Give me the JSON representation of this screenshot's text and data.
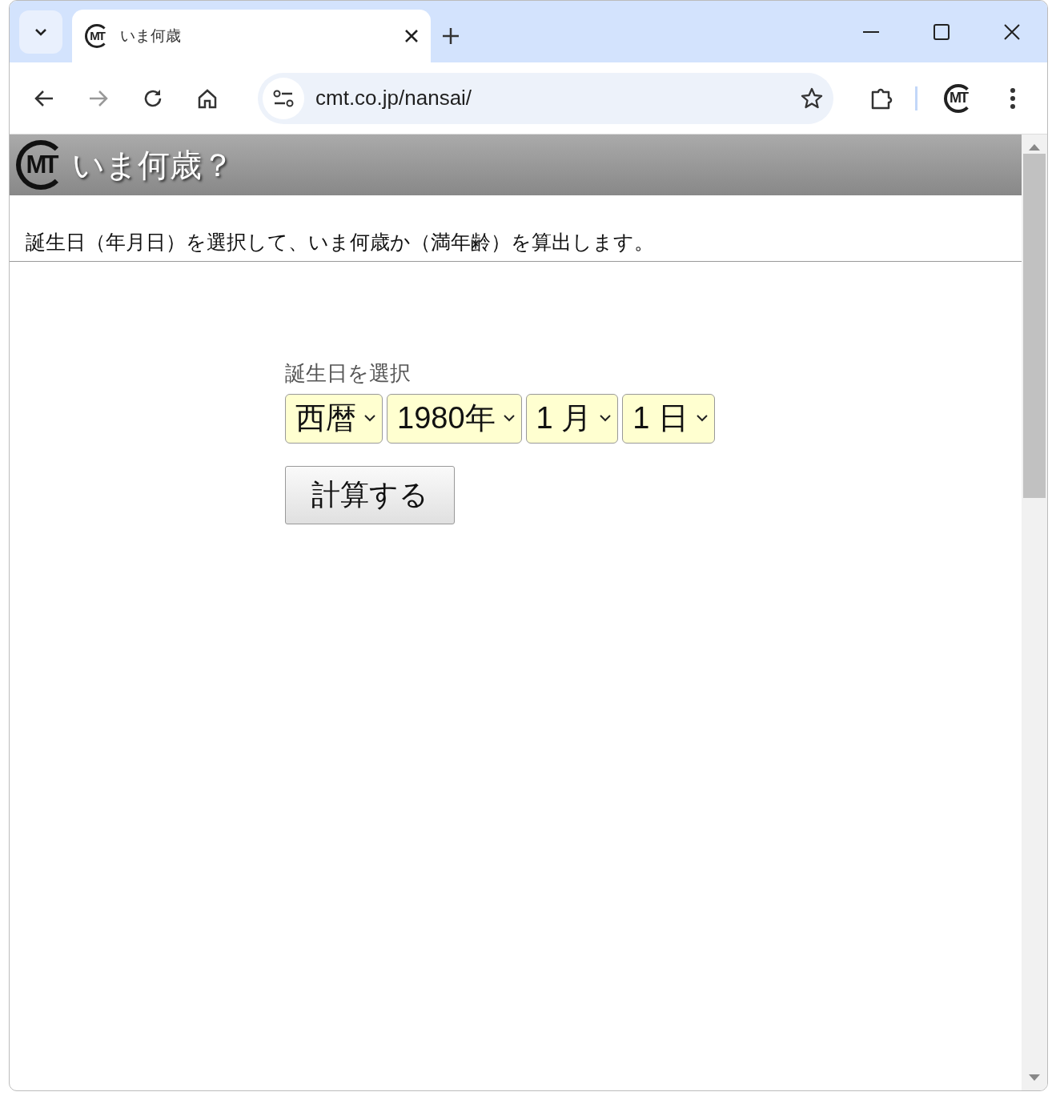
{
  "browser": {
    "tab": {
      "title": "いま何歳",
      "logo": "MT",
      "selected": true
    },
    "url": "cmt.co.jp/nansai/",
    "profile_logo": "MT"
  },
  "page": {
    "logo": "MT",
    "title": "いま何歳？",
    "description": "誕生日（年月日）を選択して、いま何歳か（満年齢）を算出します。",
    "form_label": "誕生日を選択",
    "selects": [
      {
        "value": "西暦"
      },
      {
        "value": "1980年"
      },
      {
        "value": "1 月"
      },
      {
        "value": "1 日"
      }
    ],
    "submit": "計算する"
  }
}
